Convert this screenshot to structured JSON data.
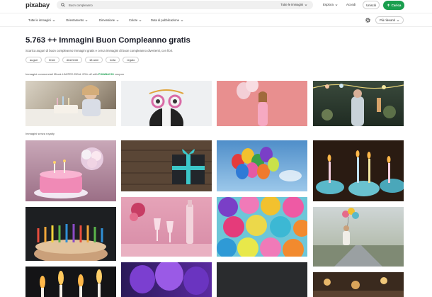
{
  "header": {
    "logo": "pixabay",
    "search_value": "Buon compleanno",
    "search_type": "Tutte le immagini",
    "explore": "Esplora",
    "login": "Accedi",
    "join": "Unisciti",
    "upload": "Carica"
  },
  "filters": {
    "all_images": "Tutte le immagini",
    "orientation": "Orientamento",
    "size": "Dimensione",
    "color": "Colore",
    "date": "Data di pubblicazione",
    "sort": "Più rilevanti"
  },
  "main": {
    "title": "5.763 ++ Immagini Buon Compleanno gratis",
    "subtitle": "Scarica auguri di buon compleanno immagini gratis e cerca immagini di buon compleanno divertenti, con fiori.",
    "tags": [
      "auguri",
      "feste",
      "divertenti",
      "18 anni",
      "torta",
      "regalo"
    ],
    "promo_text": "Immagini commerciali iStock LIMITED DEAL 20% off with ",
    "promo_code": "PIXABAY20",
    "promo_suffix": " coupon",
    "royalty_label": "Immagini senza royalty"
  },
  "colors": {
    "brand_green": "#1a9e4e",
    "text_dark": "#191b26"
  },
  "icons": {
    "search": "search-icon",
    "upload": "upload-icon",
    "settings": "gear-icon",
    "chevron": "chevron-down-icon"
  }
}
